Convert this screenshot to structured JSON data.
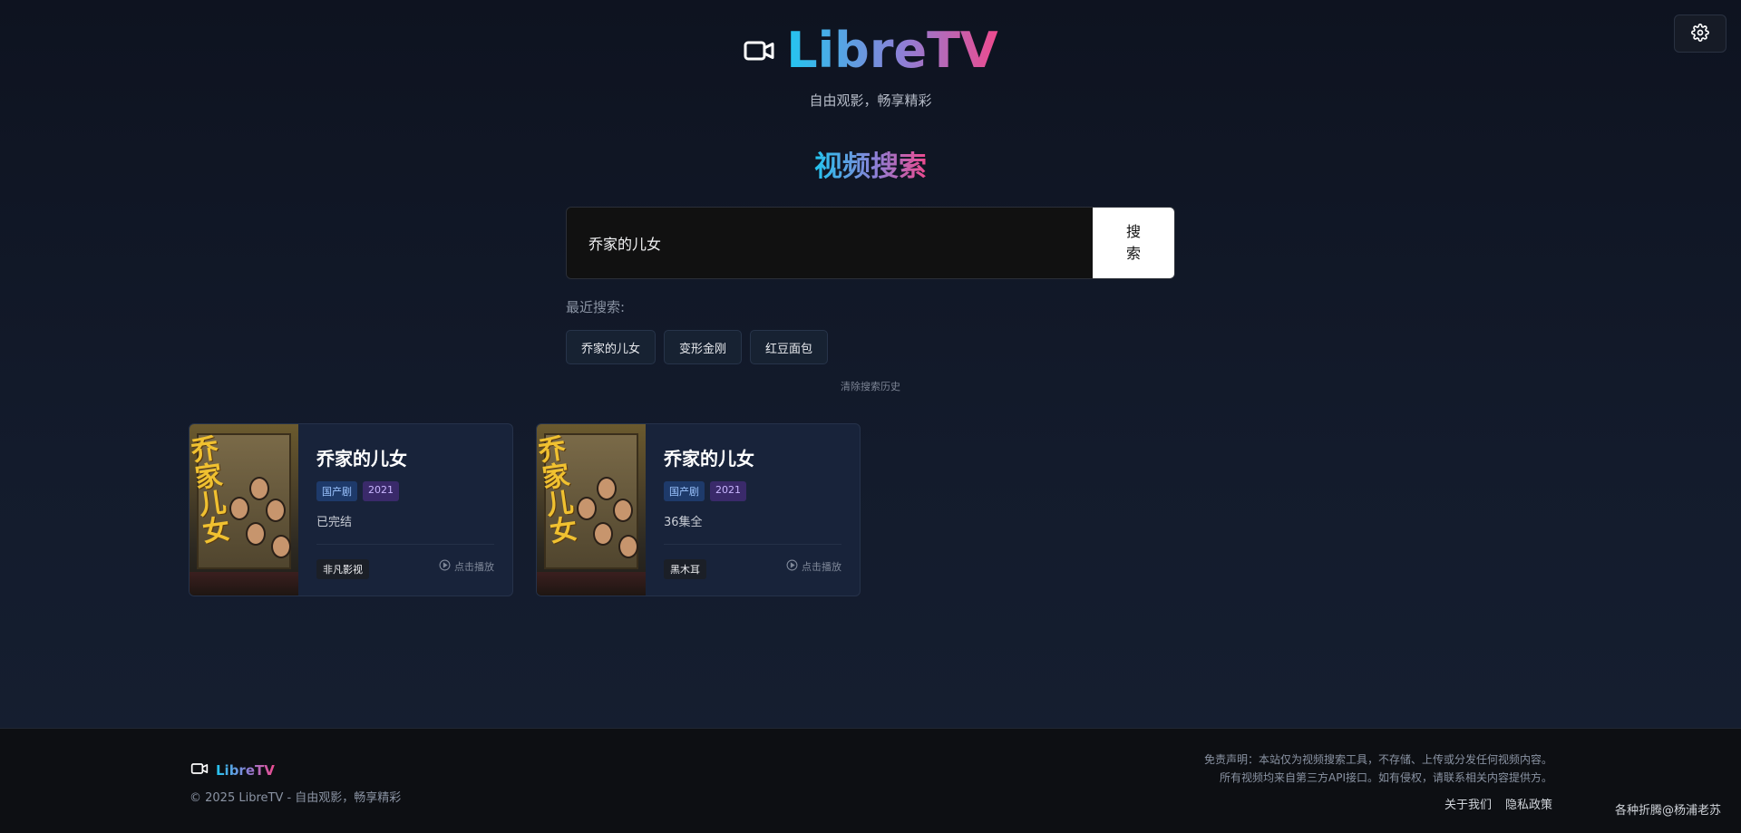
{
  "header": {
    "brand_title": "LibreTV",
    "subtitle": "自由观影，畅享精彩"
  },
  "search": {
    "section_title": "视频搜索",
    "value": "乔家的儿女",
    "button_label": "搜索"
  },
  "recent": {
    "label": "最近搜索:",
    "items": [
      "乔家的儿女",
      "变形金刚",
      "红豆面包"
    ],
    "clear_label": "清除搜索历史"
  },
  "results": [
    {
      "title": "乔家的儿女",
      "type": "国产剧",
      "year": "2021",
      "status": "已完结",
      "source": "非凡影视",
      "play_label": "点击播放",
      "poster_text": "乔家儿女"
    },
    {
      "title": "乔家的儿女",
      "type": "国产剧",
      "year": "2021",
      "status": "36集全",
      "source": "黑木耳",
      "play_label": "点击播放",
      "poster_text": "乔家儿女"
    }
  ],
  "footer": {
    "brand_title": "LibreTV",
    "copyright": "© 2025 LibreTV - 自由观影，畅享精彩",
    "disclaimer_line1": "免责声明：本站仅为视频搜索工具，不存储、上传或分发任何视频内容。",
    "disclaimer_line2": "所有视频均来自第三方API接口。如有侵权，请联系相关内容提供方。",
    "links": [
      "关于我们",
      "隐私政策"
    ],
    "credit": "各种折腾@杨浦老苏"
  },
  "icons": {
    "settings": "gear-icon",
    "brand": "video-camera-icon",
    "play": "play-circle-icon"
  },
  "colors": {
    "gradient_start": "#22c6f0",
    "gradient_mid": "#8e7fd6",
    "gradient_end": "#ee4a8e",
    "background": "#0e1320",
    "card_bg": "#18233a"
  }
}
